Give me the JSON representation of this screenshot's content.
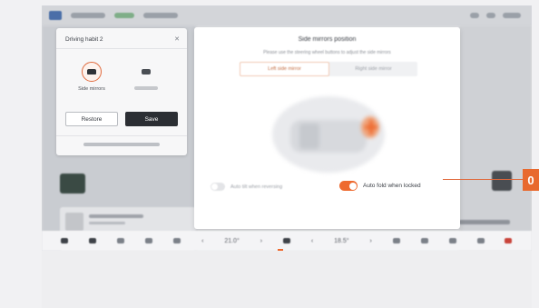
{
  "habit_panel": {
    "title": "Driving habit 2",
    "close_icon": "close-icon",
    "option_selected_label": "Side mirrors",
    "restore_label": "Restore",
    "save_label": "Save"
  },
  "mirror_panel": {
    "title": "Side mirrors position",
    "subtitle": "Please use the steering wheel buttons to adjust the side mirrors",
    "tabs": [
      {
        "label": "Left side mirror",
        "active": true
      },
      {
        "label": "Right side mirror",
        "active": false
      }
    ],
    "auto_tilt_label": "Auto tilt when reversing",
    "auto_tilt_on": false,
    "auto_fold_label": "Auto fold when locked",
    "auto_fold_on": true
  },
  "dock": {
    "temp_left": "21.0°",
    "temp_right": "18.5°"
  },
  "callout": {
    "number": "0"
  },
  "colors": {
    "accent": "#ee6a2f",
    "dark_button": "#2b2e33"
  }
}
